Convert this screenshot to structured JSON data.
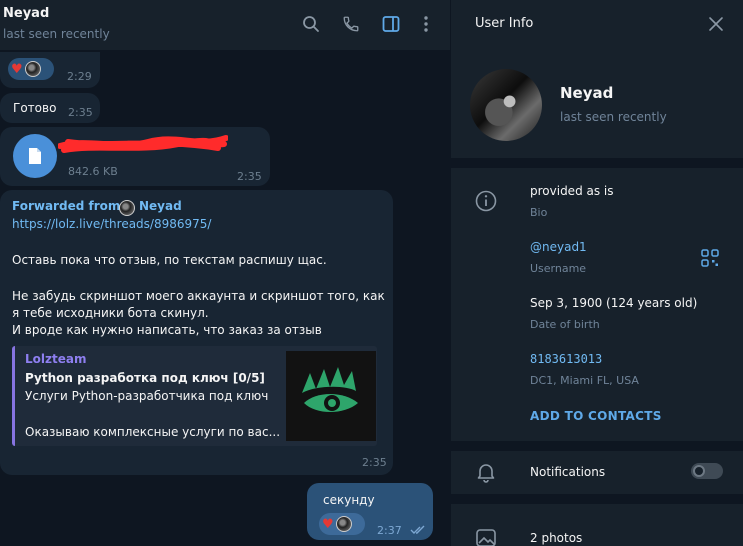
{
  "chat": {
    "name": "Neyad",
    "status": "last seen recently",
    "messages": {
      "m1_time": "2:29",
      "m2_text": "Готово",
      "m2_time": "2:35",
      "m3_file_size": "842.6 KB",
      "m3_time": "2:35",
      "m4_forwarded_label": "Forwarded from",
      "m4_forwarded_name": "Neyad",
      "m4_link": "https://lolz.live/threads/8986975/",
      "m4_text1": "Оставь пока что отзыв, по текстам распишу щас.",
      "m4_text2": "Не забудь скриншот моего аккаунта и скриншот того, как\nя тебе исходники бота скинул.\nИ вроде как нужно написать, что заказ за отзыв",
      "m4_preview_site": "Lolzteam",
      "m4_preview_title": "Python разработка под ключ [0/5]",
      "m4_preview_desc": "Услуги Python-разработчика под ключ",
      "m4_preview_desc2": "Оказываю комплексные услуги по вас...",
      "m4_time": "2:35",
      "m5_text": "секунду",
      "m5_time": "2:37"
    }
  },
  "info": {
    "title": "User Info",
    "name": "Neyad",
    "status": "last seen recently",
    "bio": "provided as is",
    "bio_label": "Bio",
    "username": "@neyad1",
    "username_label": "Username",
    "birthday": "Sep 3, 1900 (124 years old)",
    "birthday_label": "Date of birth",
    "phone": "8183613013",
    "location": "DC1, Miami FL, USA",
    "add_contact": "ADD TO CONTACTS",
    "notifications": "Notifications",
    "notifications_enabled": false,
    "photos": "2 photos"
  },
  "colors": {
    "accent": "#71baf3",
    "incoming_bubble": "#182533",
    "outgoing_bubble": "#2b5278",
    "background": "#0e1621",
    "panel": "#17212b"
  },
  "icons": [
    "search-icon",
    "phone-icon",
    "sidebar-toggle-icon",
    "more-icon",
    "close-icon",
    "info-icon",
    "qr-icon",
    "bell-icon",
    "photo-icon",
    "file-icon"
  ]
}
